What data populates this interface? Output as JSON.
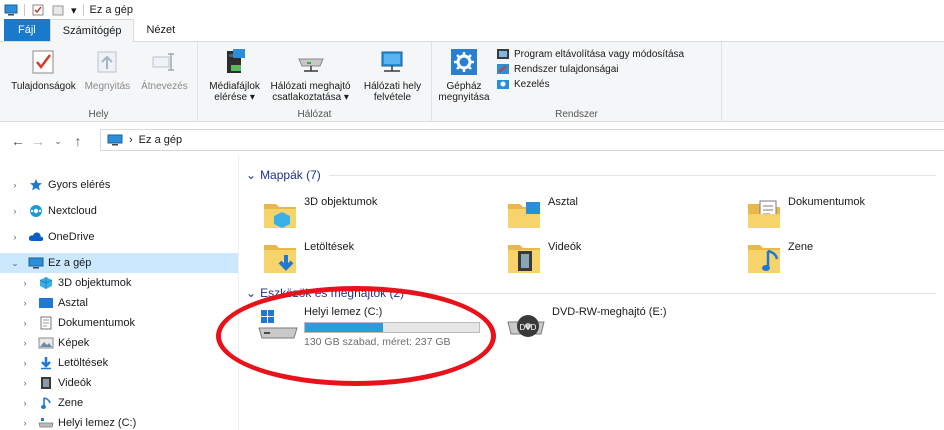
{
  "window": {
    "title": "Ez a gép"
  },
  "tabs": [
    {
      "label": "Fájl"
    },
    {
      "label": "Számítógép"
    },
    {
      "label": "Nézet"
    }
  ],
  "ribbon": {
    "hely": {
      "label": "Hely",
      "buttons": [
        {
          "label": "Tulajdonságok"
        },
        {
          "label": "Megnyitás"
        },
        {
          "label": "Átnevezés"
        }
      ]
    },
    "halozat": {
      "label": "Hálózat",
      "buttons": [
        {
          "line1": "Médiafájlok",
          "line2": "elérése ▾"
        },
        {
          "line1": "Hálózati meghajtó",
          "line2": "csatlakoztatása ▾"
        },
        {
          "line1": "Hálózati hely",
          "line2": "felvétele"
        }
      ]
    },
    "rendszer": {
      "label": "Rendszer",
      "big_button": {
        "line1": "Gépház",
        "line2": "megnyitása"
      },
      "items": [
        {
          "label": "Program eltávolítása vagy módosítása"
        },
        {
          "label": "Rendszer tulajdonságai"
        },
        {
          "label": "Kezelés"
        }
      ]
    }
  },
  "address": {
    "path": "Ez a gép",
    "separator": "›"
  },
  "navigation": {
    "items": [
      {
        "label": "Gyors elérés"
      },
      {
        "label": "Nextcloud"
      },
      {
        "label": "OneDrive"
      },
      {
        "label": "Ez a gép"
      },
      {
        "label": "3D objektumok"
      },
      {
        "label": "Asztal"
      },
      {
        "label": "Dokumentumok"
      },
      {
        "label": "Képek"
      },
      {
        "label": "Letöltések"
      },
      {
        "label": "Videók"
      },
      {
        "label": "Zene"
      },
      {
        "label": "Helyi lemez (C:)"
      }
    ]
  },
  "content": {
    "folders_section": "Mappák (7)",
    "folders": [
      {
        "label": "3D objektumok"
      },
      {
        "label": "Asztal"
      },
      {
        "label": "Dokumentumok"
      },
      {
        "label": "Letöltések"
      },
      {
        "label": "Videók"
      },
      {
        "label": "Zene"
      }
    ],
    "drives_section": "Eszközök és meghajtók (2)",
    "drives": [
      {
        "label": "Helyi lemez (C:)",
        "detail": "130 GB szabad, méret: 237 GB",
        "used_fraction": 0.45
      },
      {
        "label": "DVD-RW-meghajtó (E:)",
        "badge": "DVD"
      }
    ]
  },
  "colors": {
    "accent": "#1979ca",
    "selection": "#cce8ff",
    "highlight_ring": "#e8121b",
    "section_text": "#1e3287"
  }
}
